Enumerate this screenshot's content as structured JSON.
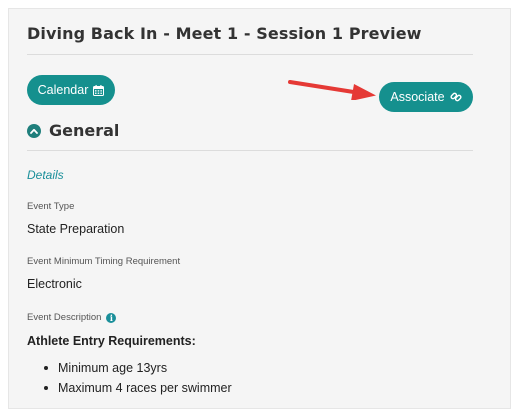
{
  "page": {
    "title": "Diving Back In - Meet 1 - Session 1 Preview"
  },
  "toolbar": {
    "calendar_label": "Calendar",
    "calendar_icon": "calendar-icon",
    "associate_label": "Associate",
    "associate_icon": "link-icon"
  },
  "section": {
    "title": "General",
    "toggle_icon": "chevron-up-icon",
    "subheading": "Details"
  },
  "fields": {
    "event_type_label": "Event Type",
    "event_type_value": "State Preparation",
    "timing_label": "Event Minimum Timing Requirement",
    "timing_value": "Electronic",
    "description_label": "Event Description",
    "description_info_icon": "info-icon"
  },
  "description": {
    "heading": "Athlete Entry Requirements:",
    "items": [
      "Minimum age 13yrs",
      "Maximum 4 races per swimmer"
    ]
  },
  "colors": {
    "accent": "#15908e",
    "annotation_arrow": "#e53935",
    "link_text": "#1a8f9a"
  }
}
